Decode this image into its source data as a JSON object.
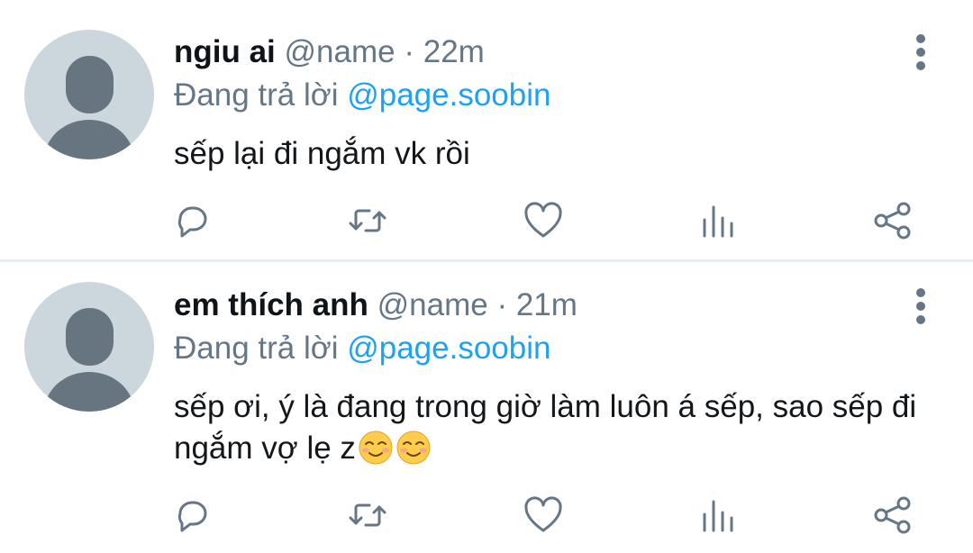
{
  "tweets": [
    {
      "name": "ngiu ai",
      "handle": "@name",
      "separator": "·",
      "time": "22m",
      "replying_prefix": "Đang trả lời",
      "replying_to": "@page.soobin",
      "text": "sếp lại đi ngắm vk rồi",
      "emojis": []
    },
    {
      "name": "em thích anh",
      "handle": "@name",
      "separator": "·",
      "time": "21m",
      "replying_prefix": "Đang trả lời",
      "replying_to": "@page.soobin",
      "text": "sếp ơi, ý là đang trong giờ làm luôn á sếp, sao sếp đi ngắm vợ lẹ z",
      "emojis": [
        "smiling-face-emoji",
        "smiling-face-emoji"
      ]
    }
  ],
  "icons": {
    "more": "more-vertical-icon",
    "reply": "reply-bubble-icon",
    "retweet": "retweet-icon",
    "like": "heart-icon",
    "analytics": "analytics-bars-icon",
    "share": "share-icon"
  },
  "colors": {
    "text": "#14171a",
    "secondary": "#657786",
    "link": "#1da1f2",
    "divider": "#e6ecf0",
    "avatar_bg": "#ccd6dd",
    "avatar_fg": "#66757f"
  }
}
